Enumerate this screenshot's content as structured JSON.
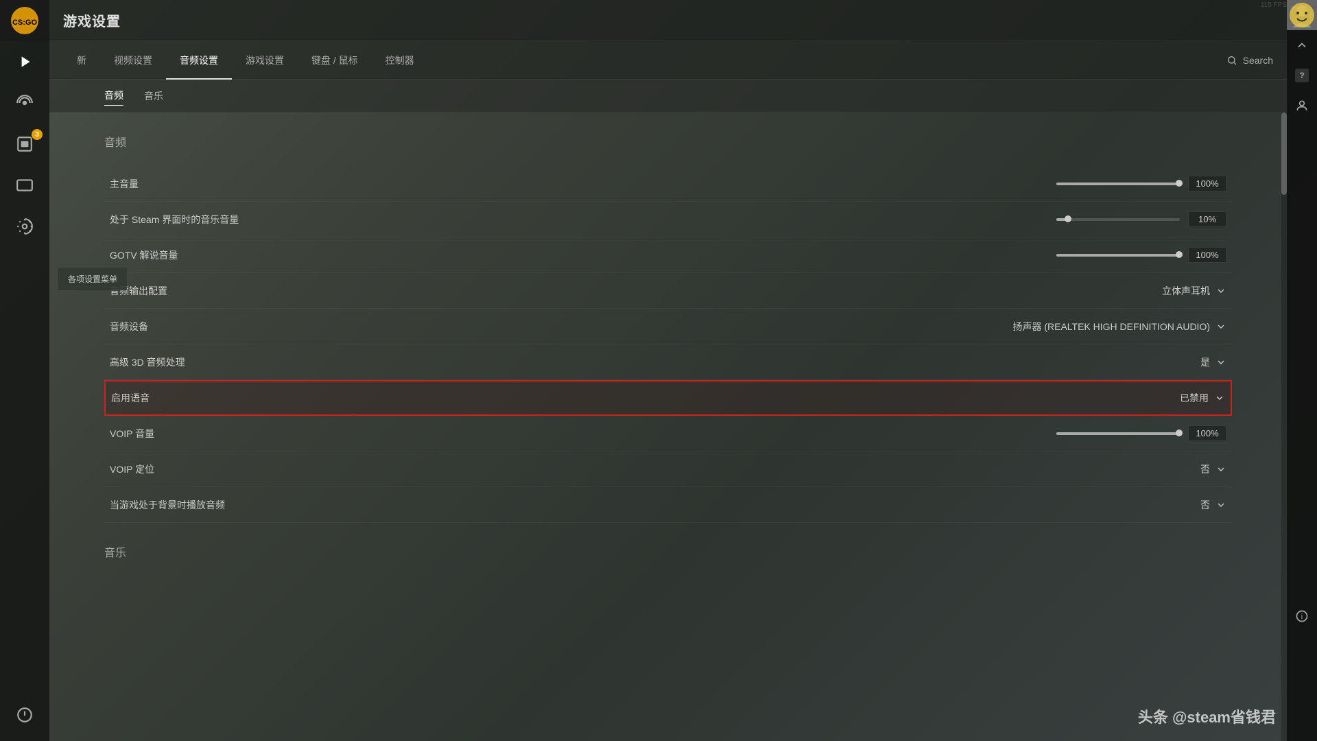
{
  "fps": "115 FPS",
  "title": "游戏设置",
  "nav": {
    "tabs": [
      {
        "id": "new",
        "label": "新"
      },
      {
        "id": "video",
        "label": "视频设置"
      },
      {
        "id": "audio",
        "label": "音频设置",
        "active": true
      },
      {
        "id": "game",
        "label": "游戏设置"
      },
      {
        "id": "keyboard",
        "label": "键盘 / 鼠标"
      },
      {
        "id": "controller",
        "label": "控制器"
      }
    ],
    "search_label": "Search"
  },
  "sub_tabs": [
    {
      "id": "audio",
      "label": "音频",
      "active": true
    },
    {
      "id": "music",
      "label": "音乐"
    }
  ],
  "settings_menu_label": "各项设置菜单",
  "sections": {
    "audio": {
      "title": "音频",
      "rows": [
        {
          "id": "master_volume",
          "label": "主音量",
          "type": "slider",
          "fill_pct": 100,
          "value": "100%"
        },
        {
          "id": "steam_music_volume",
          "label": "处于 Steam 界面时的音乐音量",
          "type": "slider",
          "fill_pct": 10,
          "value": "10%"
        },
        {
          "id": "gotv_volume",
          "label": "GOTV 解说音量",
          "type": "slider",
          "fill_pct": 100,
          "value": "100%"
        },
        {
          "id": "audio_output",
          "label": "音频输出配置",
          "type": "dropdown",
          "value": "立体声耳机"
        },
        {
          "id": "audio_device",
          "label": "音频设备",
          "type": "dropdown",
          "value": "扬声器 (REALTEK HIGH DEFINITION AUDIO)"
        },
        {
          "id": "audio_3d",
          "label": "高级 3D 音频处理",
          "type": "dropdown",
          "value": "是"
        },
        {
          "id": "enable_voice",
          "label": "启用语音",
          "type": "dropdown",
          "value": "已禁用",
          "highlighted": true
        },
        {
          "id": "voip_volume",
          "label": "VOIP 音量",
          "type": "slider",
          "fill_pct": 100,
          "value": "100%"
        },
        {
          "id": "voip_position",
          "label": "VOIP 定位",
          "type": "dropdown",
          "value": "否"
        },
        {
          "id": "background_audio",
          "label": "当游戏处于背景时播放音频",
          "type": "dropdown",
          "value": "否"
        }
      ]
    },
    "music": {
      "title": "音乐"
    }
  },
  "watermark": "头条 @steam省钱君"
}
